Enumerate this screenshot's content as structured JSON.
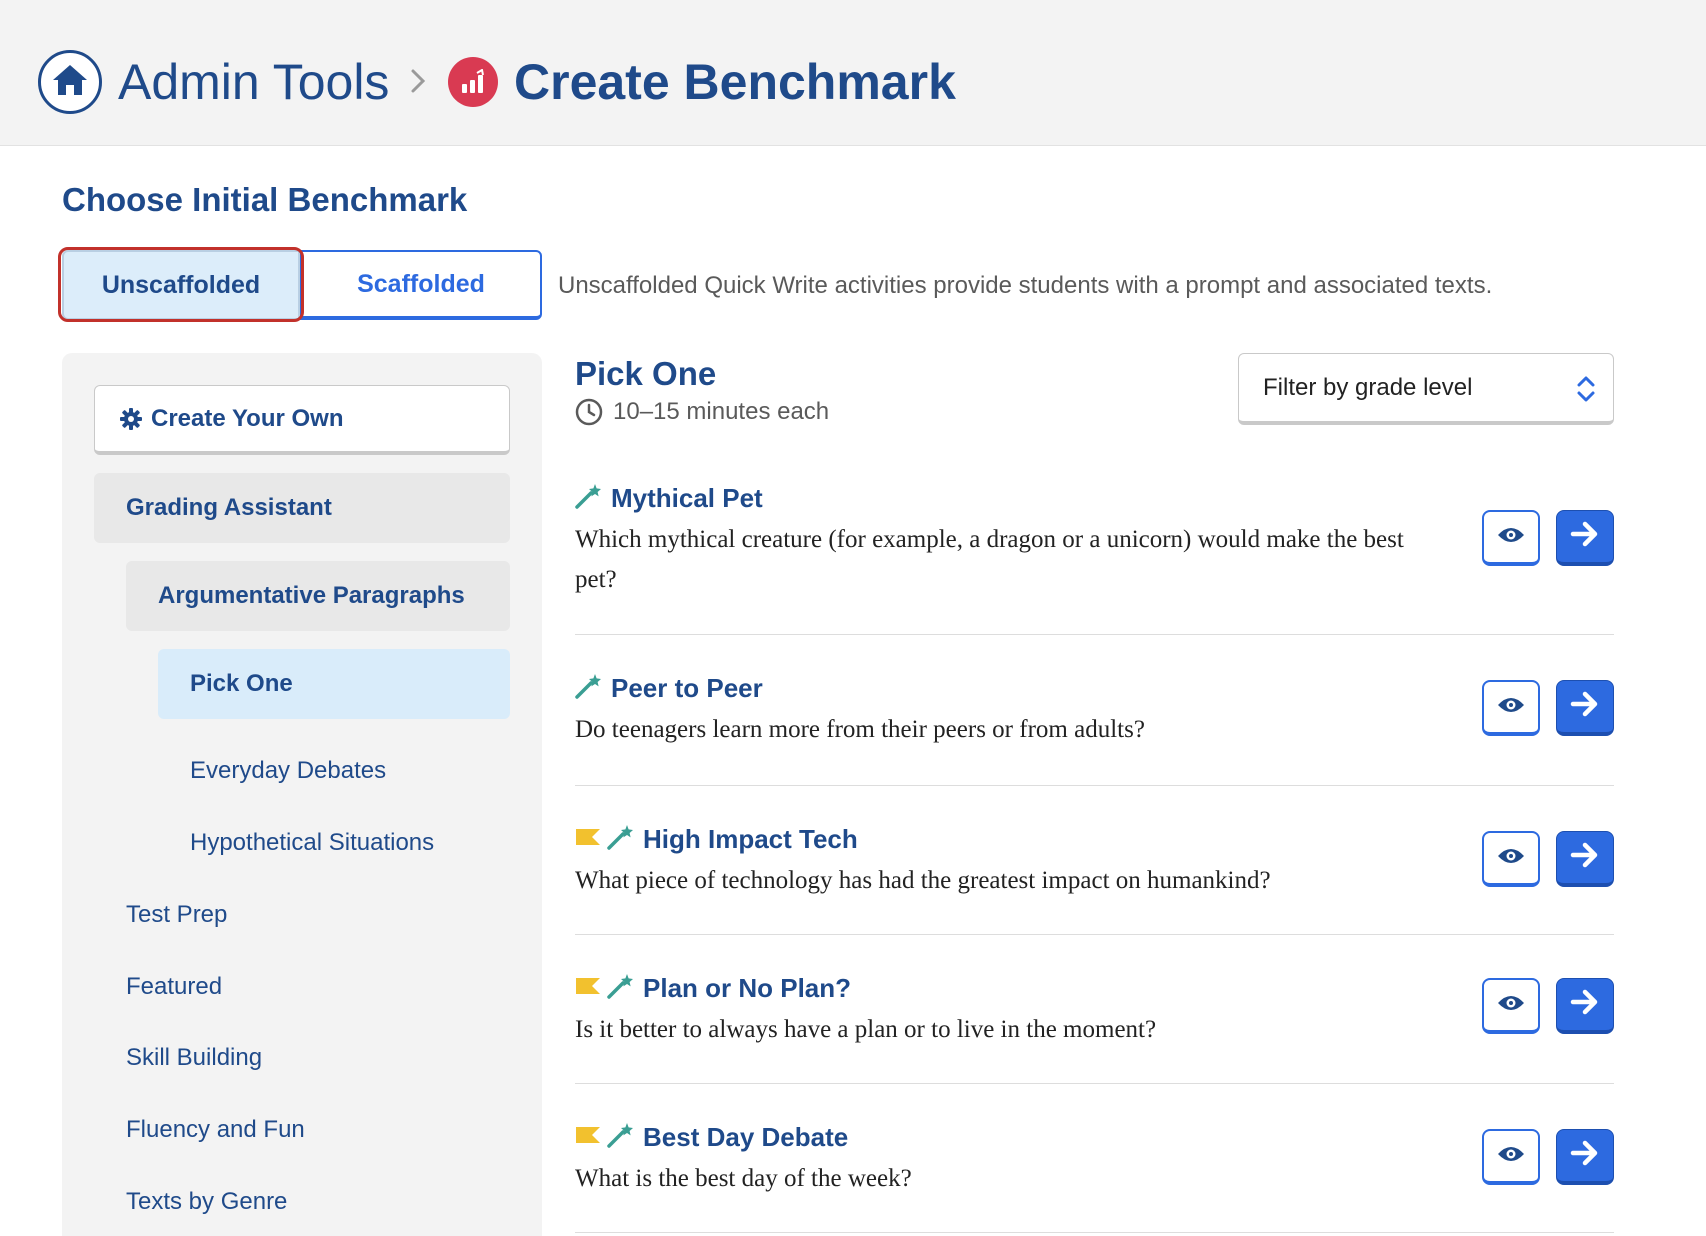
{
  "header": {
    "breadcrumb_parent": "Admin Tools",
    "title": "Create Benchmark"
  },
  "section_title": "Choose Initial Benchmark",
  "toggle": {
    "unscaffolded_label": "Unscaffolded",
    "scaffolded_label": "Scaffolded",
    "selected": "Unscaffolded",
    "description": "Unscaffolded Quick Write activities provide students with a prompt and associated texts."
  },
  "sidebar": {
    "create_own_label": "Create Your Own",
    "grading_assistant": "Grading Assistant",
    "argumentative_paragraphs": "Argumentative Paragraphs",
    "pick_one": "Pick One",
    "everyday_debates": "Everyday Debates",
    "hypothetical_situations": "Hypothetical Situations",
    "test_prep": "Test Prep",
    "featured": "Featured",
    "skill_building": "Skill Building",
    "fluency_and_fun": "Fluency and Fun",
    "texts_by_genre": "Texts by Genre"
  },
  "main": {
    "title": "Pick One",
    "duration": "10–15 minutes each",
    "filter_placeholder": "Filter by grade level",
    "activities": [
      {
        "title": "Mythical Pet",
        "prompt": "Which mythical creature (for example, a dragon or a unicorn) would make the best pet?",
        "flagged": false
      },
      {
        "title": "Peer to Peer",
        "prompt": "Do teenagers learn more from their peers or from adults?",
        "flagged": false
      },
      {
        "title": "High Impact Tech",
        "prompt": "What piece of technology has had the greatest impact on humankind?",
        "flagged": true
      },
      {
        "title": "Plan or No Plan?",
        "prompt": "Is it better to always have a plan or to live in the moment?",
        "flagged": true
      },
      {
        "title": "Best Day Debate",
        "prompt": "What is the best day of the week?",
        "flagged": true
      }
    ]
  },
  "colors": {
    "navy": "#1f4a8a",
    "accent_blue": "#2d6ae0",
    "selected_bg": "#dcedfa",
    "focus_red": "#c2312b",
    "benchmark_red": "#d93a52",
    "flag_yellow": "#f2c12e",
    "wand_teal": "#3a9e93"
  },
  "icons": {
    "home": "home-icon",
    "separator": "chevron-right-icon",
    "benchmark": "bar-chart-icon",
    "create": "gear-icon",
    "clock": "clock-icon",
    "filter": "chevron-up-down-icon",
    "flag": "flag-icon",
    "wand": "magic-wand-icon",
    "preview": "eye-icon",
    "assign": "arrow-right-icon"
  }
}
